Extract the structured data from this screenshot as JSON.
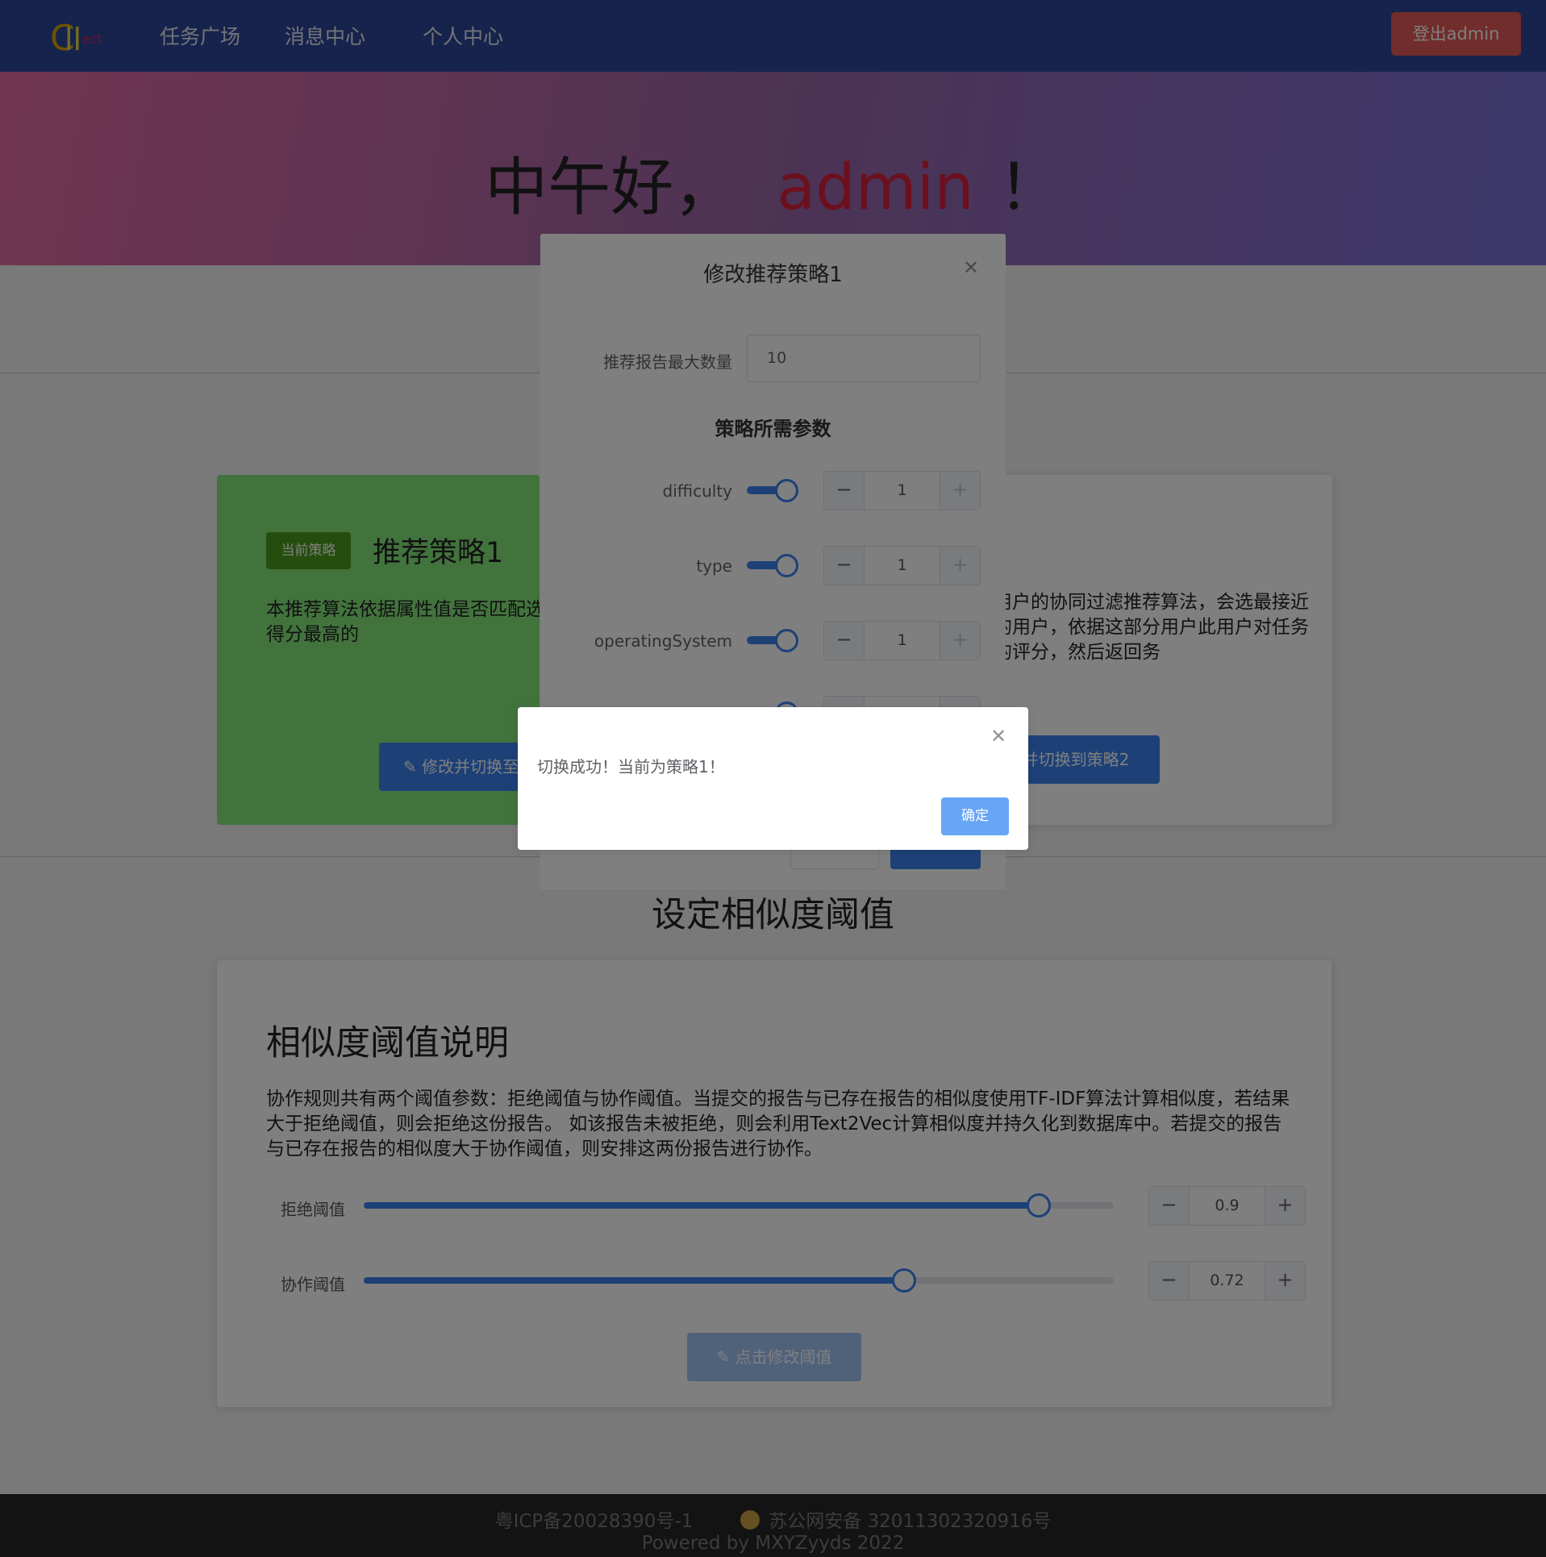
{
  "nav": {
    "logo_text": "Collect",
    "items": [
      {
        "label": "任务广场"
      },
      {
        "label": "消息中心"
      },
      {
        "label": "个人中心"
      }
    ],
    "logout_label": "登出admin"
  },
  "hero": {
    "greeting": "中午好，",
    "name": "admin",
    "exclaim": "！"
  },
  "strategy1": {
    "badge": "当前策略",
    "title": "推荐策略1",
    "desc": "本推荐算法依据属性值是否匹配选取指定数量的属性值加权得分最高的",
    "button": "修改并切换至"
  },
  "strategy2": {
    "desc": "用户的协同过滤推荐算法，会选最接近的用户，依据这部分用户此用户对任务的评分，然后返回务",
    "button": "并切换到策略2"
  },
  "threshold": {
    "section_title": "设定相似度阈值",
    "card_title": "相似度阈值说明",
    "desc": "协作规则共有两个阈值参数：拒绝阈值与协作阈值。当提交的报告与已存在报告的相似度使用TF-IDF算法计算相似度，若结果大于拒绝阈值，则会拒绝这份报告。 如该报告未被拒绝，则会利用Text2Vec计算相似度并持久化到数据库中。若提交的报告与已存在报告的相似度大于协作阈值，则安排这两份报告进行协作。",
    "reject": {
      "label": "拒绝阈值",
      "value": "0.9",
      "fraction": 0.9
    },
    "collab": {
      "label": "协作阈值",
      "value": "0.72",
      "fraction": 0.72
    },
    "submit": "点击修改阈值"
  },
  "footer": {
    "icp": "粤ICP备20028390号-1",
    "police": "苏公网安备 32011302320916号",
    "powered": "Powered by MXYZyyds 2022"
  },
  "dialog": {
    "title": "修改推荐策略1",
    "max_label": "推荐报告最大数量",
    "max_value": "10",
    "params_title": "策略所需参数",
    "params": [
      {
        "name": "difficulty",
        "value": "1"
      },
      {
        "name": "type",
        "value": "1"
      },
      {
        "name": "operatingSystem",
        "value": "1"
      }
    ]
  },
  "message": {
    "text": "切换成功！当前为策略1！",
    "ok": "确定"
  },
  "colors": {
    "header": "#2d4799",
    "accent": "#3b82ee",
    "danger": "#e35a56",
    "current_badge": "#4a9a1a"
  }
}
